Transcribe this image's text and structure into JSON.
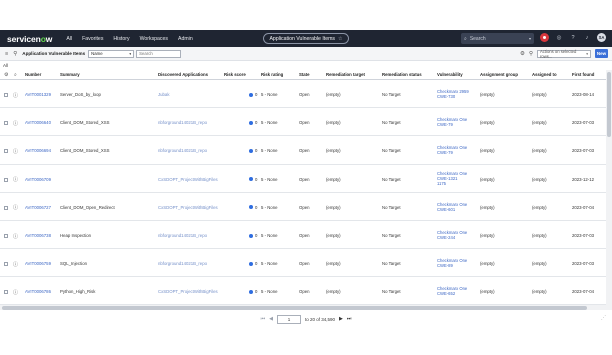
{
  "nav": {
    "logo_text": "servicenow",
    "links": [
      "All",
      "Favorites",
      "History",
      "Workspaces",
      "Admin"
    ],
    "page_title": "Application Vulnerable Items",
    "search_placeholder": "Search",
    "avatar_initials": "SA"
  },
  "toolbar": {
    "title": "Application Vulnerable Items",
    "field_select": "Name",
    "search_placeholder": "Search",
    "actions_placeholder": "Actions on selected rows...",
    "new_label": "New"
  },
  "breadcrumb": "All",
  "columns": [
    "Number",
    "Summary",
    "Discovered Applications",
    "Risk score",
    "Risk rating",
    "State",
    "Remediation target",
    "Remediation status",
    "Vulnerability",
    "Assignment group",
    "Assigned to",
    "First found"
  ],
  "rows": [
    {
      "number": "AVIT0001329",
      "summary": "Server_DoS_by_loop",
      "app": "Jubak",
      "risk_score": "0",
      "risk_rating": "5 - None",
      "state": "Open",
      "rem_target": "(empty)",
      "rem_status": "No Target",
      "vuln": [
        "Checkmarx 2959",
        "CWE-730"
      ],
      "group": "(empty)",
      "assigned": "(empty)",
      "first": "2023-08-14"
    },
    {
      "number": "AVIT0006640",
      "summary": "Client_DOM_Stored_XSS",
      "app": "nbforground14021B_repo",
      "risk_score": "0",
      "risk_rating": "5 - None",
      "state": "Open",
      "rem_target": "(empty)",
      "rem_status": "No Target",
      "vuln": [
        "Checkmarx One",
        "CWE-79"
      ],
      "group": "(empty)",
      "assigned": "(empty)",
      "first": "2023-07-03"
    },
    {
      "number": "AVIT0006694",
      "summary": "Client_DOM_Stored_XSS",
      "app": "nbforground14021B_repo",
      "risk_score": "0",
      "risk_rating": "5 - None",
      "state": "Open",
      "rem_target": "(empty)",
      "rem_status": "No Target",
      "vuln": [
        "Checkmarx One",
        "CWE-79"
      ],
      "group": "(empty)",
      "assigned": "(empty)",
      "first": "2023-07-03"
    },
    {
      "number": "AVIT0006709",
      "summary": "",
      "app": "CxSDOPT_ProjectWithBigFiles",
      "risk_score": "0",
      "risk_rating": "5 - None",
      "state": "Open",
      "rem_target": "(empty)",
      "rem_status": "No Target",
      "vuln": [
        "Checkmarx One",
        "CWE-1321",
        "1175"
      ],
      "group": "(empty)",
      "assigned": "(empty)",
      "first": "2023-12-12"
    },
    {
      "number": "AVIT0006727",
      "summary": "Client_DOM_Open_Redirect",
      "app": "CxSDOPT_ProjectWithBigFiles",
      "risk_score": "0",
      "risk_rating": "5 - None",
      "state": "Open",
      "rem_target": "(empty)",
      "rem_status": "No Target",
      "vuln": [
        "Checkmarx One",
        "CWE-601"
      ],
      "group": "(empty)",
      "assigned": "(empty)",
      "first": "2023-07-04"
    },
    {
      "number": "AVIT0006738",
      "summary": "Heap Inspection",
      "app": "nbforground14021B_repo",
      "risk_score": "0",
      "risk_rating": "5 - None",
      "state": "Open",
      "rem_target": "(empty)",
      "rem_status": "No Target",
      "vuln": [
        "Checkmarx One",
        "CWE-244"
      ],
      "group": "(empty)",
      "assigned": "(empty)",
      "first": "2023-07-03"
    },
    {
      "number": "AVIT0006759",
      "summary": "SQL_Injection",
      "app": "nbforground14021B_repo",
      "risk_score": "0",
      "risk_rating": "5 - None",
      "state": "Open",
      "rem_target": "(empty)",
      "rem_status": "No Target",
      "vuln": [
        "Checkmarx One",
        "CWE-89"
      ],
      "group": "(empty)",
      "assigned": "(empty)",
      "first": "2023-07-03"
    },
    {
      "number": "AVIT0006786",
      "summary": "Python_High_Risk",
      "app": "CxSDOPT_ProjectWithBigFiles",
      "risk_score": "0",
      "risk_rating": "5 - None",
      "state": "Open",
      "rem_target": "(empty)",
      "rem_status": "No Target",
      "vuln": [
        "Checkmarx One",
        "CWE-652"
      ],
      "group": "(empty)",
      "assigned": "(empty)",
      "first": "2023-07-04"
    }
  ],
  "pagination": {
    "page_value": "1",
    "range_text": "to 20 of 34,590"
  }
}
